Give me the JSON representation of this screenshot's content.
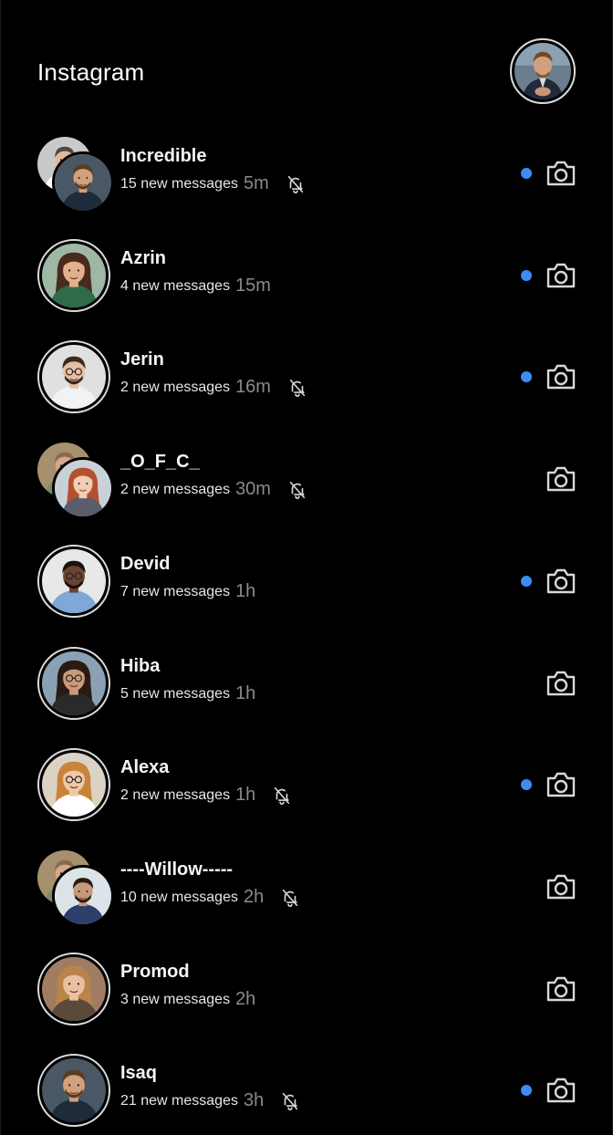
{
  "app": {
    "title": "Instagram"
  },
  "profile": {
    "icon": "profile-avatar"
  },
  "colors": {
    "background": "#000000",
    "unread": "#3b8cf5",
    "time": "#8a8a8a"
  },
  "threads": [
    {
      "name": "Incredible",
      "count": "15 new messages",
      "time": "5m",
      "muted": true,
      "unread": true,
      "group": true
    },
    {
      "name": "Azrin",
      "count": "4 new messages",
      "time": "15m",
      "muted": false,
      "unread": true,
      "group": false
    },
    {
      "name": "Jerin",
      "count": "2 new messages",
      "time": "16m",
      "muted": true,
      "unread": true,
      "group": false
    },
    {
      "name": "_O_F_C_",
      "count": "2 new messages",
      "time": "30m",
      "muted": true,
      "unread": false,
      "group": true
    },
    {
      "name": "Devid",
      "count": "7 new messages",
      "time": "1h",
      "muted": false,
      "unread": true,
      "group": false
    },
    {
      "name": "Hiba",
      "count": "5 new messages",
      "time": "1h",
      "muted": false,
      "unread": false,
      "group": false
    },
    {
      "name": "Alexa",
      "count": "2 new messages",
      "time": "1h",
      "muted": true,
      "unread": true,
      "group": false
    },
    {
      "name": "----Willow-----",
      "count": "10 new messages",
      "time": "2h",
      "muted": true,
      "unread": false,
      "group": true
    },
    {
      "name": "Promod",
      "count": "3 new messages",
      "time": "2h",
      "muted": false,
      "unread": false,
      "group": false
    },
    {
      "name": "Isaq",
      "count": "21 new messages",
      "time": "3h",
      "muted": true,
      "unread": true,
      "group": false
    }
  ]
}
